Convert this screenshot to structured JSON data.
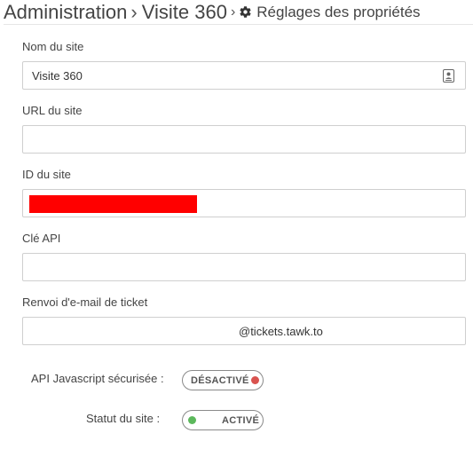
{
  "breadcrumb": {
    "root": "Administration",
    "site": "Visite 360",
    "separator": "›",
    "page": "Réglages des propriétés",
    "page_icon": "gear-icon"
  },
  "form": {
    "site_name": {
      "label": "Nom du site",
      "value": "Visite 360",
      "icon": "contact-card-icon"
    },
    "site_url": {
      "label": "URL du site",
      "value": ""
    },
    "site_id": {
      "label": "ID du site",
      "value": ""
    },
    "api_key": {
      "label": "Clé API",
      "value": ""
    },
    "ticket_forward": {
      "label": "Renvoi d'e-mail de ticket",
      "value": "@tickets.tawk.to"
    }
  },
  "toggles": {
    "secure_js_api": {
      "label": "API Javascript sécurisée :",
      "state": "DÉSACTIVÉ",
      "dot_color": "#d9534f"
    },
    "site_status": {
      "label": "Statut du site :",
      "state": "ACTIVÉ",
      "dot_color": "#5cb85c"
    }
  },
  "colors": {
    "border": "#cfcfcf",
    "redaction": "#ff0000"
  }
}
